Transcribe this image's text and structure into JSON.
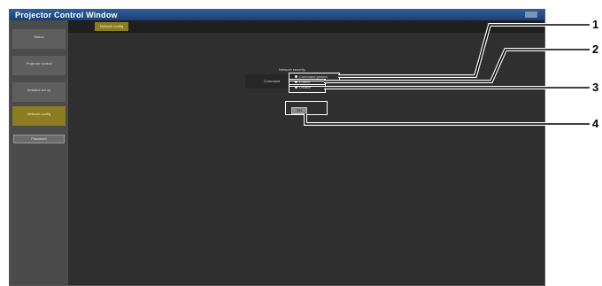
{
  "window": {
    "title": "Projector Control Window"
  },
  "sidebar": {
    "items": [
      {
        "label": "Status"
      },
      {
        "label": "Projector control"
      },
      {
        "label": "Detailed set up"
      },
      {
        "label": "Network config"
      }
    ],
    "button": "Password"
  },
  "tabs": [
    {
      "label": "Network config"
    }
  ],
  "settings": {
    "section_title": "Network security",
    "row_label": "Command",
    "options": [
      {
        "label": "Command protect",
        "selected": true
      },
      {
        "label": "Enable",
        "selected": false
      },
      {
        "label": "Disable",
        "selected": false
      }
    ],
    "set_button": "Set"
  },
  "callouts": [
    "1",
    "2",
    "3",
    "4"
  ]
}
